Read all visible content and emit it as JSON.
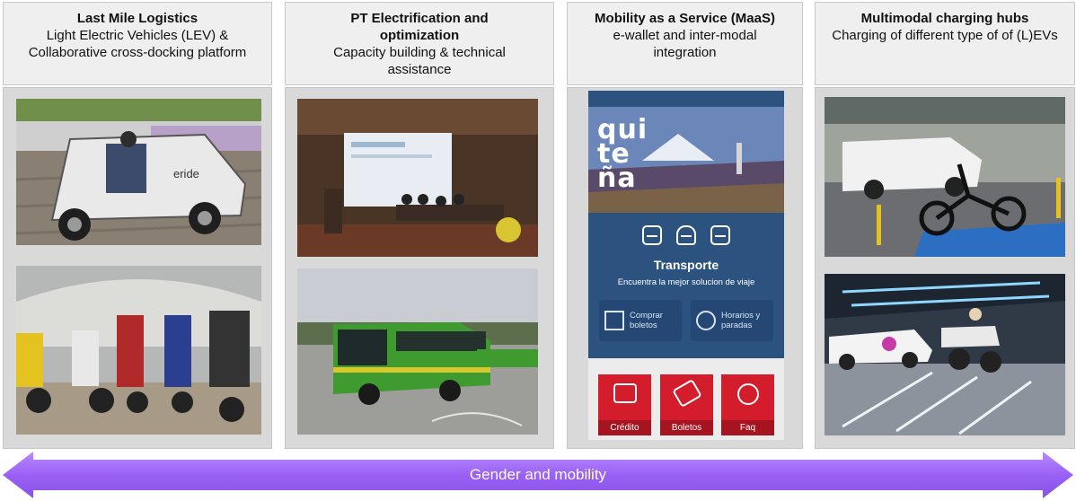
{
  "columns": [
    {
      "title": "Last Mile Logistics",
      "subtitle": "Light Electric Vehicles (LEV) & Collaborative cross-docking platform"
    },
    {
      "title": "PT Electrification and optimization",
      "subtitle": "Capacity building & technical assistance"
    },
    {
      "title": "Mobility as a Service (MaaS)",
      "subtitle": "e-wallet and inter-modal integration"
    },
    {
      "title": "Multimodal charging hubs",
      "subtitle": "Charging of different type of of (L)EVs"
    }
  ],
  "photos": {
    "lev_vehicle_sign": "eride"
  },
  "maas_app": {
    "brand": "quiteña",
    "brand_lines": [
      "qui",
      "te",
      "ña"
    ],
    "section_title": "Transporte",
    "section_subtitle": "Encuentra la mejor solucion de viaje",
    "options": [
      {
        "label": "Comprar boletos",
        "icon": "ticket-grid-icon"
      },
      {
        "label": "Horarios y paradas",
        "icon": "clock-icon"
      }
    ],
    "tiles": [
      {
        "label": "Crédito",
        "icon": "wallet-icon"
      },
      {
        "label": "Boletos",
        "icon": "ticket-icon"
      },
      {
        "label": "Faq",
        "icon": "info-icon"
      }
    ],
    "transport_icons": [
      "bus-icon",
      "metro-icon",
      "trolley-icon"
    ]
  },
  "banner": {
    "label": "Gender and mobility"
  },
  "colors": {
    "banner_purple": "#a06bff",
    "app_blue": "#2c5280",
    "tile_red": "#d41d2c",
    "bus_green": "#3f9b2f"
  }
}
